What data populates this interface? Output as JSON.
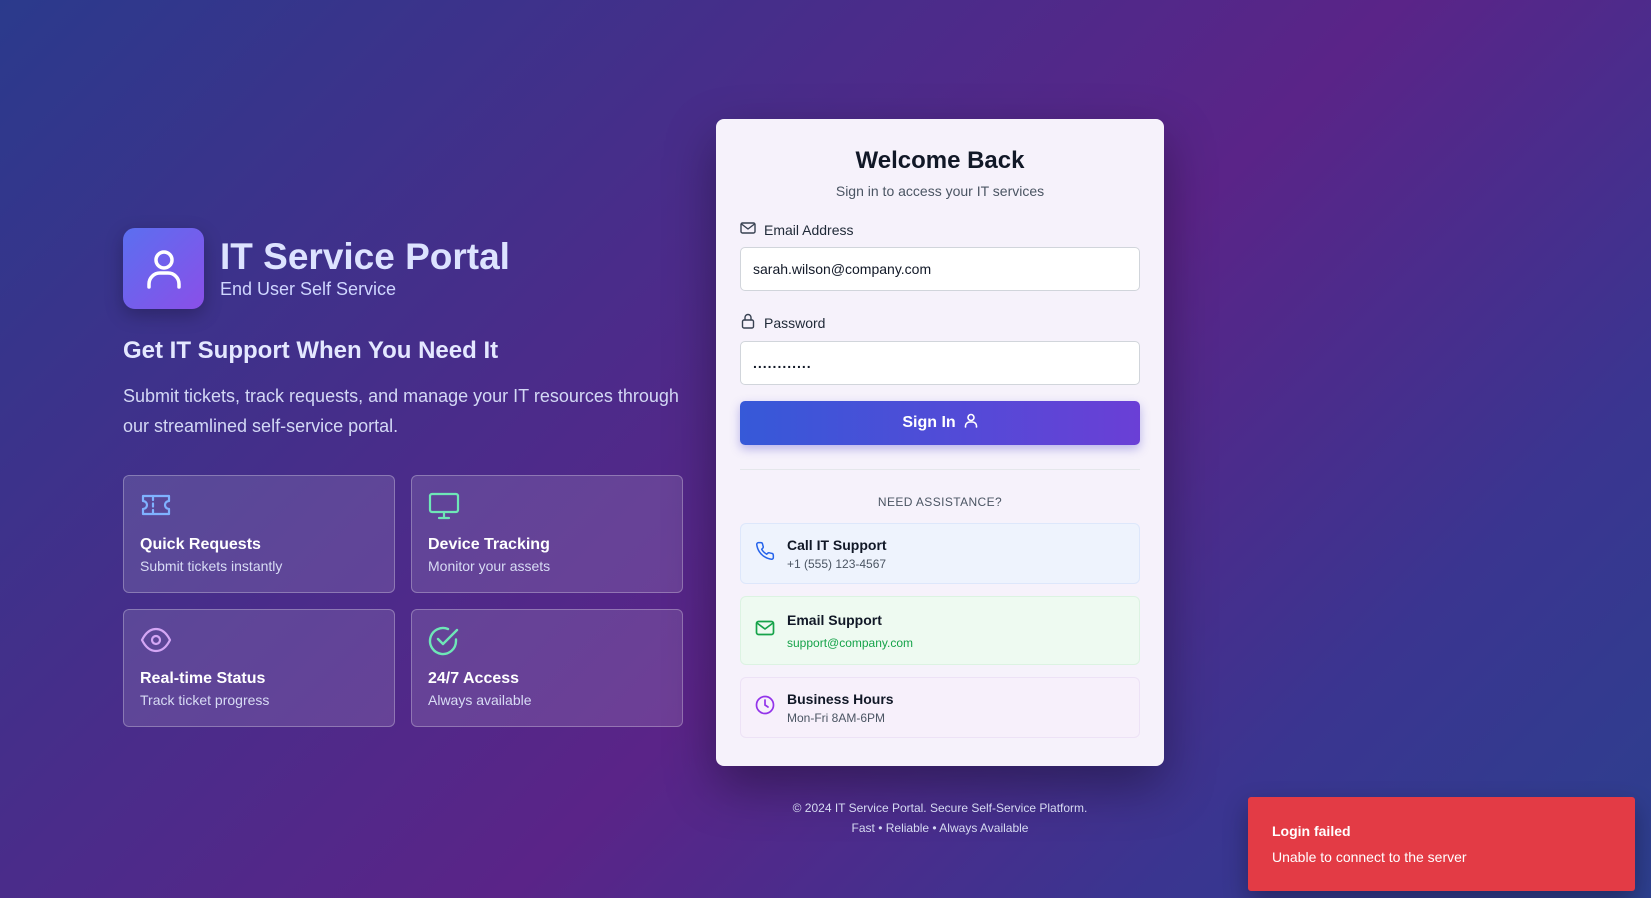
{
  "brand": {
    "title": "IT Service Portal",
    "subtitle": "End User Self Service"
  },
  "hero": {
    "tagline": "Get IT Support When You Need It",
    "description": "Submit tickets, track requests, and manage your IT resources through our streamlined self-service portal."
  },
  "features": [
    {
      "icon": "ticket-icon",
      "title": "Quick Requests",
      "desc": "Submit tickets instantly"
    },
    {
      "icon": "monitor-icon",
      "title": "Device Tracking",
      "desc": "Monitor your assets"
    },
    {
      "icon": "eye-icon",
      "title": "Real-time Status",
      "desc": "Track ticket progress"
    },
    {
      "icon": "check-circle-icon",
      "title": "24/7 Access",
      "desc": "Always available"
    }
  ],
  "login": {
    "title": "Welcome Back",
    "subtitle": "Sign in to access your IT services",
    "email_label": "Email Address",
    "email_value": "sarah.wilson@company.com",
    "password_label": "Password",
    "password_value": "............",
    "signin_label": "Sign In",
    "assist_heading": "NEED ASSISTANCE?"
  },
  "contacts": [
    {
      "icon": "phone-icon",
      "title": "Call IT Support",
      "value": "+1 (555) 123-4567"
    },
    {
      "icon": "mail-icon",
      "title": "Email Support",
      "value": "support@company.com"
    },
    {
      "icon": "clock-icon",
      "title": "Business Hours",
      "value": "Mon-Fri 8AM-6PM"
    }
  ],
  "footer": {
    "line1": "© 2024 IT Service Portal. Secure Self-Service Platform.",
    "line2": "Fast • Reliable • Always Available"
  },
  "toast": {
    "title": "Login failed",
    "message": "Unable to connect to the server"
  },
  "colors": {
    "accent_start": "#3659d8",
    "accent_end": "#6a3fd6",
    "error": "#e33b45",
    "success": "#16a34a"
  }
}
